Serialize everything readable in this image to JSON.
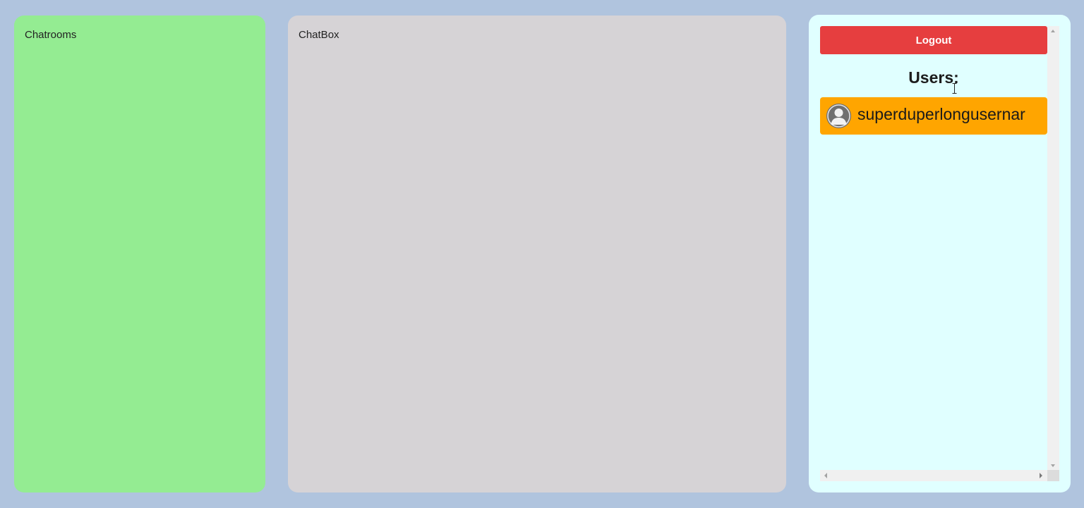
{
  "chatrooms": {
    "label": "Chatrooms"
  },
  "chatbox": {
    "label": "ChatBox"
  },
  "users_panel": {
    "logout_label": "Logout",
    "heading": "Users:",
    "users": [
      {
        "name": "superduperlongusernar",
        "avatar_icon": "user-avatar-icon"
      }
    ]
  },
  "colors": {
    "background": "#b0c4de",
    "chatrooms_bg": "#94ec92",
    "chatbox_bg": "#d6d3d6",
    "users_bg": "#e0ffff",
    "logout_bg": "#e63e3f",
    "user_item_bg": "#ffa500"
  }
}
